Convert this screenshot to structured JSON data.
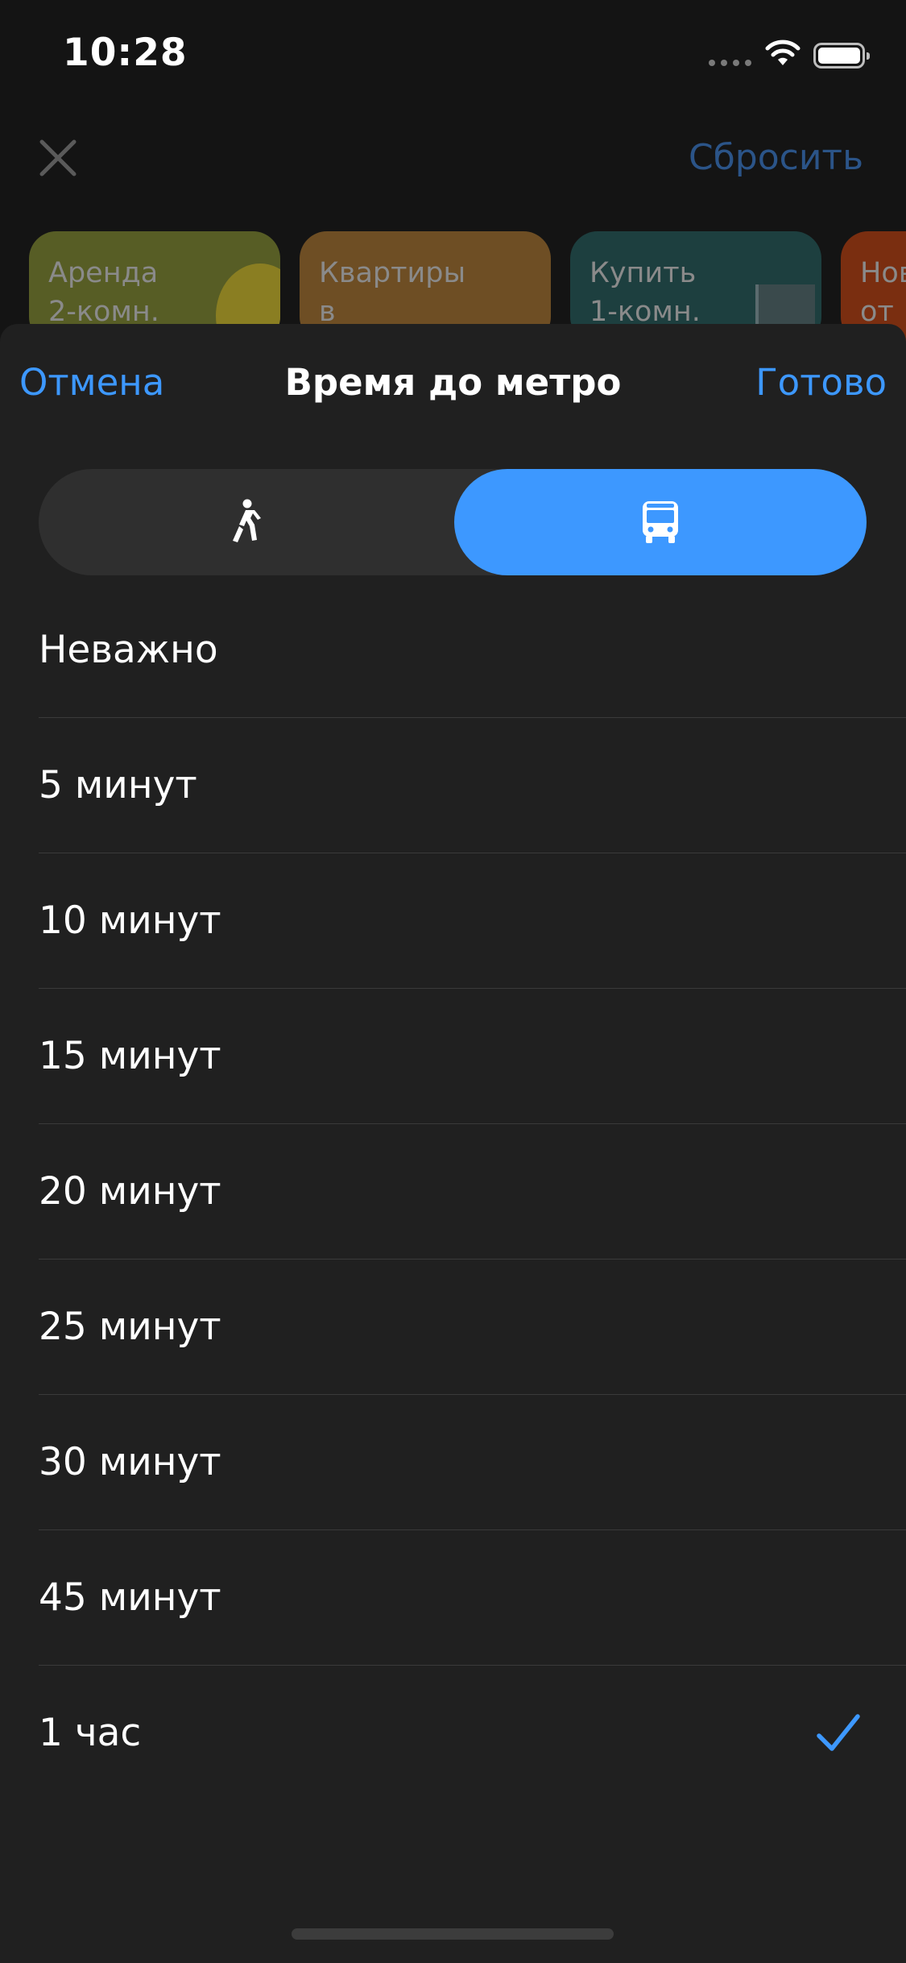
{
  "status_bar": {
    "time": "10:28"
  },
  "background": {
    "close_icon": "close-icon",
    "reset_label": "Сбросить",
    "cards": [
      {
        "line1": "Аренда",
        "line2": "2-комн.",
        "color": "#575d25"
      },
      {
        "line1": "Квартиры",
        "line2": "в новостройке",
        "color": "#6e4e24"
      },
      {
        "line1": "Купить",
        "line2": "1-комн.",
        "color": "#1d3f3f"
      },
      {
        "line1": "Нов",
        "line2": "от Г",
        "color": "#7a2e10"
      }
    ]
  },
  "sheet": {
    "cancel_label": "Отмена",
    "title": "Время до метро",
    "done_label": "Готово",
    "modes": [
      {
        "icon": "walking-person-icon",
        "selected": false
      },
      {
        "icon": "bus-icon",
        "selected": true
      }
    ],
    "options": [
      {
        "label": "Неважно",
        "selected": false
      },
      {
        "label": "5 минут",
        "selected": false
      },
      {
        "label": "10 минут",
        "selected": false
      },
      {
        "label": "15 минут",
        "selected": false
      },
      {
        "label": "20 минут",
        "selected": false
      },
      {
        "label": "25 минут",
        "selected": false
      },
      {
        "label": "30 минут",
        "selected": false
      },
      {
        "label": "45 минут",
        "selected": false
      },
      {
        "label": "1 час",
        "selected": true
      }
    ]
  },
  "colors": {
    "accent": "#3d98ff",
    "sheet_background": "#202020",
    "page_background": "#141414",
    "dimmed_accent": "#2b5488"
  }
}
